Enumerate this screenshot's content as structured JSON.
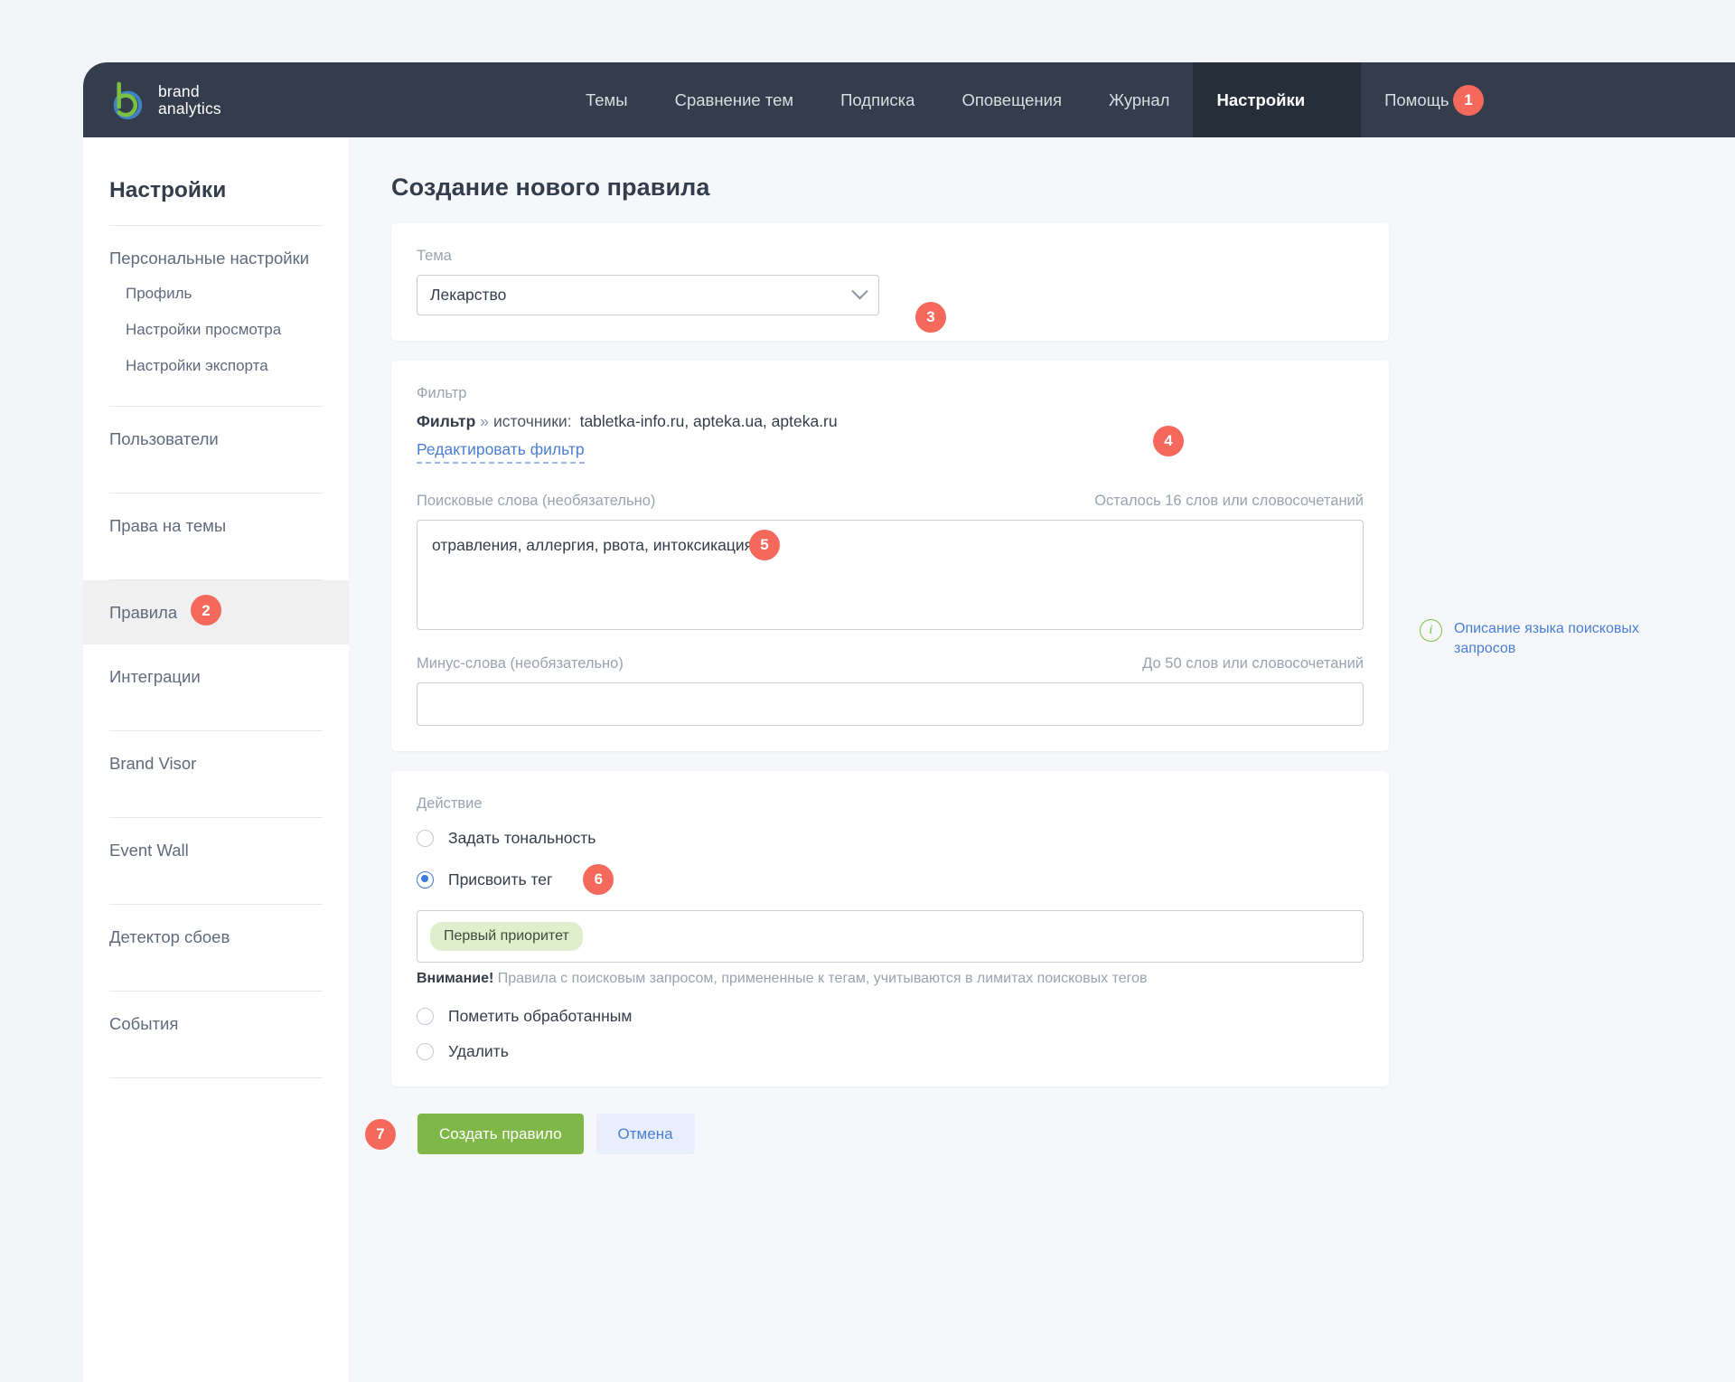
{
  "brand": {
    "line1": "brand",
    "line2": "analytics"
  },
  "nav": {
    "items": [
      {
        "label": "Темы",
        "active": false
      },
      {
        "label": "Сравнение тем",
        "active": false
      },
      {
        "label": "Подписка",
        "active": false
      },
      {
        "label": "Оповещения",
        "active": false
      },
      {
        "label": "Журнал",
        "active": false
      },
      {
        "label": "Настройки",
        "active": true
      },
      {
        "label": "Помощь",
        "active": false
      }
    ]
  },
  "badges": {
    "b1": "1",
    "b2": "2",
    "b3": "3",
    "b4": "4",
    "b5": "5",
    "b6": "6",
    "b7": "7"
  },
  "sidebar": {
    "title": "Настройки",
    "personal": "Персональные настройки",
    "sub": [
      {
        "label": "Профиль"
      },
      {
        "label": "Настройки просмотра"
      },
      {
        "label": "Настройки экспорта"
      }
    ],
    "items": [
      {
        "label": "Пользователи"
      },
      {
        "label": "Права на темы"
      },
      {
        "label": "Правила"
      },
      {
        "label": "Интеграции"
      },
      {
        "label": "Brand Visor"
      },
      {
        "label": "Event Wall"
      },
      {
        "label": "Детектор сбоев"
      },
      {
        "label": "События"
      }
    ]
  },
  "main": {
    "page_title": "Создание нового правила",
    "theme": {
      "label": "Тема",
      "value": "Лекарство"
    },
    "filter": {
      "label": "Фильтр",
      "prefix": "Фильтр",
      "chevron": "»",
      "sources_label": "источники:",
      "sources_value": "tabletka-info.ru, apteka.ua, apteka.ru",
      "edit_link": "Редактировать фильтр"
    },
    "search_words": {
      "label": "Поисковые слова (необязательно)",
      "counter": "Осталось 16 слов или словосочетаний",
      "value": "отравления, аллергия, рвота, интоксикация"
    },
    "minus_words": {
      "label": "Минус-слова (необязательно)",
      "counter": "До 50 слов или словосочетаний",
      "value": ""
    },
    "action": {
      "label": "Действие",
      "options": [
        {
          "label": "Задать тональность",
          "selected": false
        },
        {
          "label": "Присвоить тег",
          "selected": true
        },
        {
          "label": "Пометить обработанным",
          "selected": false
        },
        {
          "label": "Удалить",
          "selected": false
        }
      ],
      "tag_chip": "Первый приоритет",
      "warning_bold": "Внимание!",
      "warning_text": "Правила с поисковым запросом, примененные к тегам, учитываются в лимитах поисковых тегов"
    },
    "buttons": {
      "primary": "Создать правило",
      "secondary": "Отмена"
    }
  },
  "helper": {
    "icon": "i",
    "link": "Описание языка поисковых запросов"
  },
  "colors": {
    "navbar": "#343d4b",
    "nav_active": "#262e3a",
    "badge": "#f4695c",
    "primary_button": "#80b749",
    "link": "#4a7fd4",
    "tag_chip": "#dfeecd",
    "logo_green": "#7ac143",
    "logo_blue": "#3f82c4"
  }
}
